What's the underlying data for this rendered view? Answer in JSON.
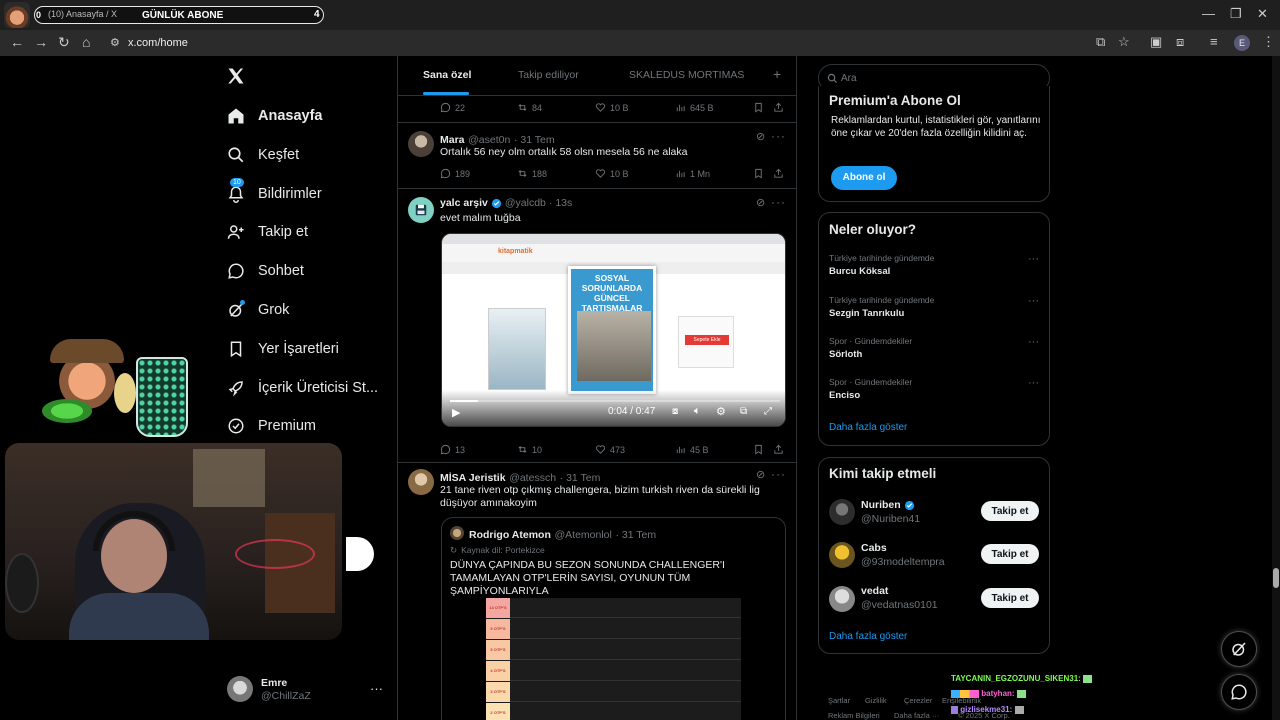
{
  "browser": {
    "tab_title": "(10) Anasayfa / X",
    "tab_badge": "0",
    "stream_title": "GÜNLÜK ABONE",
    "stream_count": "4",
    "url": "x.com/home",
    "profile_initial": "E"
  },
  "sidebar": {
    "items": [
      {
        "label": "Anasayfa",
        "icon": "home-icon"
      },
      {
        "label": "Keşfet",
        "icon": "search-icon"
      },
      {
        "label": "Bildirimler",
        "icon": "bell-icon",
        "badge": "10"
      },
      {
        "label": "Takip et",
        "icon": "person-add-icon"
      },
      {
        "label": "Sohbet",
        "icon": "chat-icon"
      },
      {
        "label": "Grok",
        "icon": "grok-icon"
      },
      {
        "label": "Yer İşaretleri",
        "icon": "bookmark-icon"
      },
      {
        "label": "İçerik Üreticisi St...",
        "icon": "rocket-icon"
      },
      {
        "label": "Premium",
        "icon": "verified-icon"
      }
    ],
    "account": {
      "name": "Emre",
      "handle": "@ChillZaZ"
    }
  },
  "feed": {
    "tabs": [
      "Sana özel",
      "Takip ediliyor",
      "SKALEDUS MORTIMAS"
    ],
    "add_tab": "+",
    "top_actions": {
      "replies": "22",
      "reposts": "84",
      "likes": "10 B",
      "views": "645 B"
    },
    "posts": [
      {
        "name": "Mara",
        "handle": "@aset0n",
        "time": "· 31 Tem",
        "text": "Ortalık 56 ney olm ortalık 58 olsn mesela 56 ne alaka",
        "replies": "189",
        "reposts": "188",
        "likes": "10 B",
        "views": "1 Mn"
      },
      {
        "name": "yalc arşiv",
        "handle": "@yalcdb",
        "time": "· 13s",
        "text": "evet malım tuğba",
        "video": {
          "time": "0:04 / 0:47",
          "progress": 0.085,
          "site_name": "kitapmatik",
          "book_title": "SOSYAL SORUNLARDA GÜNCEL TARTIŞMALAR",
          "buy_label": "Sepete Ekle"
        },
        "replies": "13",
        "reposts": "10",
        "likes": "473",
        "views": "45 B"
      },
      {
        "name": "MİSA Jeristik",
        "handle": "@atessch",
        "time": "· 31 Tem",
        "text": "21 tane riven otp çıkmış challengera, bizim turkish riven da sürekli lig düşüyor amınakoyim",
        "quote": {
          "name": "Rodrigo Atemon",
          "handle": "@Atemonlol",
          "time": "· 31 Tem",
          "translated": "Kaynak dil: Portekizce",
          "text": "DÜNYA ÇAPINDA BU SEZON SONUNDA CHALLENGER'I TAMAMLAYAN OTP'LERİN SAYISI, OYUNUN TÜM ŞAMPİYONLARIYLA",
          "rows": [
            "14 OTP'S",
            "9 OTP'S",
            "5 OTP'S",
            "4 OTP'S",
            "3 OTP'S",
            "2 OTP'S",
            "1 OTP'S"
          ]
        }
      }
    ]
  },
  "right": {
    "search_placeholder": "Ara",
    "premium": {
      "title": "Premium'a Abone Ol",
      "text": "Reklamlardan kurtul, istatistikleri gör, yanıtlarını öne çıkar ve 20'den fazla özelliğin kilidini aç.",
      "button": "Abone ol"
    },
    "trends": {
      "title": "Neler oluyor?",
      "items": [
        {
          "context": "Türkiye tarihinde gündemde",
          "name": "Burcu Köksal"
        },
        {
          "context": "Türkiye tarihinde gündemde",
          "name": "Sezgin Tanrıkulu"
        },
        {
          "context": "Spor · Gündemdekiler",
          "name": "Sörloth"
        },
        {
          "context": "Spor · Gündemdekiler",
          "name": "Enciso"
        }
      ],
      "more": "Daha fazla göster"
    },
    "who_to_follow": {
      "title": "Kimi takip etmeli",
      "items": [
        {
          "name": "Nuriben",
          "handle": "@Nuriben41",
          "button": "Takip et"
        },
        {
          "name": "Cabs",
          "handle": "@93modeltempra",
          "button": "Takip et"
        },
        {
          "name": "vedat",
          "handle": "@vedatnas0101",
          "button": "Takip et"
        }
      ],
      "more": "Daha fazla göster"
    },
    "footer": [
      "Şartlar",
      "Gizlilik",
      "Çerezler",
      "Erişilebilirlik",
      "Reklam Bilgileri",
      "Daha fazla ···",
      "© 2025 X Corp."
    ]
  },
  "overlay": {
    "chat": [
      {
        "user": "TAYCANIN_EGZOZUNU_SIKEN31:",
        "color": "#7cfc50"
      },
      {
        "user": "batyhan:",
        "color": "#ff5fd2"
      },
      {
        "user": "gizlisekme31:",
        "color": "#b58cff"
      }
    ]
  },
  "colors": {
    "accent": "#1d9bf0",
    "border": "#2f3336",
    "muted": "#71767b",
    "text": "#e7e9ea"
  }
}
